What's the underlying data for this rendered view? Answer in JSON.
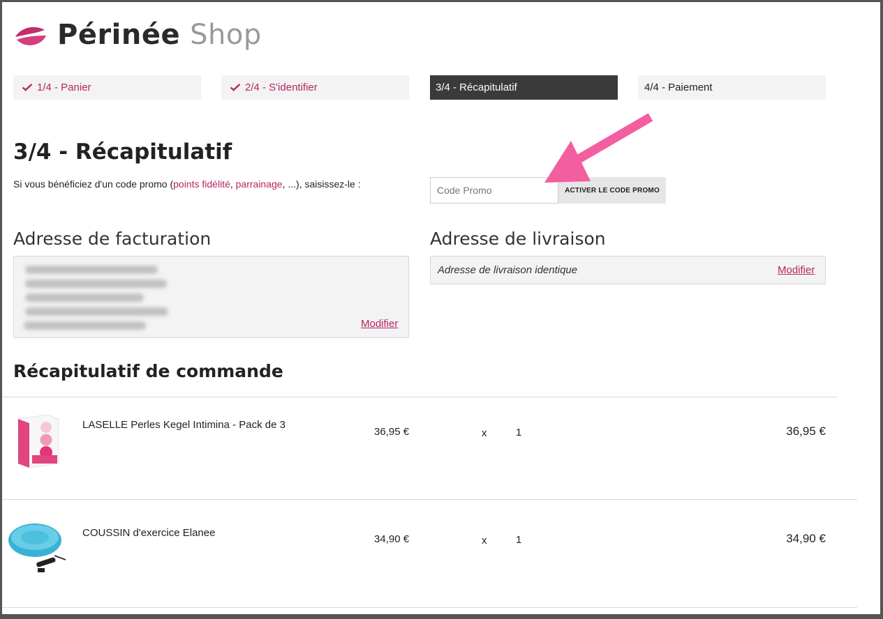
{
  "logo": {
    "brand": "Périnée",
    "shop": "Shop"
  },
  "steps": [
    {
      "label": "1/4 - Panier",
      "state": "done"
    },
    {
      "label": "2/4 - S'identifier",
      "state": "done"
    },
    {
      "label": "3/4 - Récapitulatif",
      "state": "active"
    },
    {
      "label": "4/4 - Paiement",
      "state": "todo"
    }
  ],
  "page_title": "3/4 - Récapitulatif",
  "promo": {
    "text_before": "Si vous bénéficiez d'un code promo (",
    "link_points": "points fidélité",
    "comma": ", ",
    "link_parrainage": "parrainage",
    "text_after": ", ...), saisissez-le :",
    "placeholder": "Code Promo",
    "button_label": "ACTIVER LE CODE PROMO"
  },
  "billing": {
    "title": "Adresse de facturation",
    "modify": "Modifier"
  },
  "delivery": {
    "title": "Adresse de livraison",
    "text": "Adresse de livraison identique",
    "modify": "Modifier"
  },
  "summary": {
    "title": "Récapitulatif de commande",
    "items": [
      {
        "name": "LASELLE Perles Kegel Intimina - Pack de 3",
        "unit_price": "36,95 €",
        "times": "x",
        "qty": "1",
        "total": "36,95 €"
      },
      {
        "name": "COUSSIN d'exercice Elanee",
        "unit_price": "34,90 €",
        "times": "x",
        "qty": "1",
        "total": "34,90 €"
      }
    ]
  },
  "colors": {
    "accent": "#b52462",
    "active_step": "#3a3a3a",
    "arrow": "#f35ea0"
  }
}
